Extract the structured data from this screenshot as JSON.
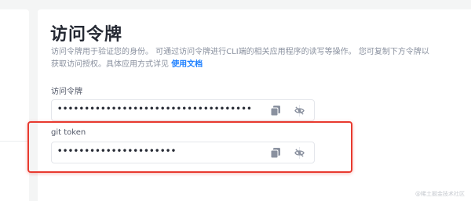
{
  "page": {
    "title": "访问令牌",
    "description": "访问令牌用于验证您的身份。 可通过访问令牌进行CLI端的相关应用程序的读写等操作。 您可复制下方令牌以获取访问授权。具体应用方式详见",
    "doc_link": "使用文档"
  },
  "fields": [
    {
      "label": "访问令牌",
      "value": "••••••••••••••••••••••••••••••••••••",
      "copy_icon": "copy-icon",
      "toggle_icon": "eye-off-icon"
    },
    {
      "label": "git token",
      "value": "••••••••••••••••••••••",
      "copy_icon": "copy-icon",
      "toggle_icon": "eye-off-icon"
    }
  ],
  "colors": {
    "accent": "#1e80ff",
    "annotation": "#e83a2f"
  },
  "watermark": "@稀土掘金技术社区"
}
